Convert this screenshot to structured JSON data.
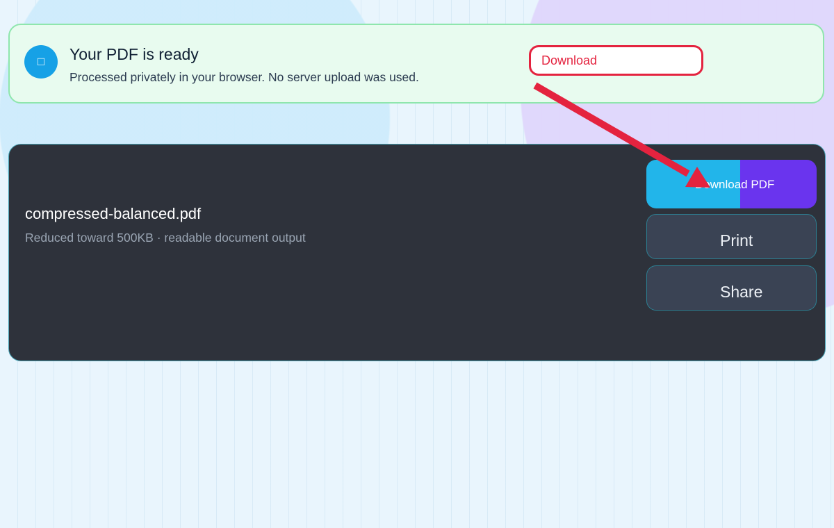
{
  "banner": {
    "icon": "document-icon",
    "title": "Your PDF is ready",
    "subtitle": "Processed privately in your browser. No server upload was used.",
    "download_label": "Download"
  },
  "file": {
    "name": "compressed-balanced.pdf",
    "meta": "Reduced toward 500KB · readable document output"
  },
  "actions": {
    "download_pdf_label": "Download PDF",
    "print_label": "Print",
    "share_label": "Share"
  },
  "colors": {
    "accent_cyan": "#22b5ea",
    "accent_purple": "#6a34ee",
    "annotation_red": "#e4233f",
    "success_border": "#8ee6ad",
    "card_background": "#2e323b"
  }
}
